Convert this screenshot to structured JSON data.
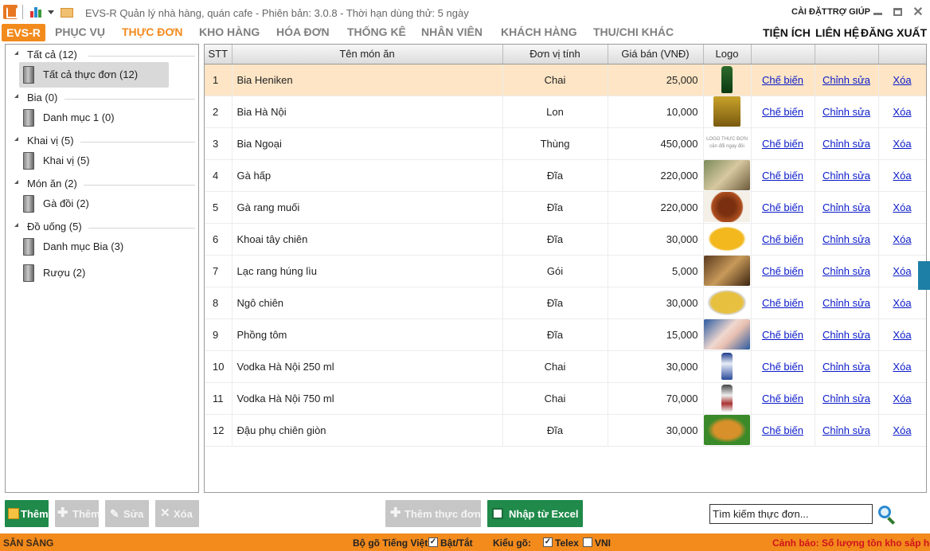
{
  "app": {
    "title": "EVS-R Quản lý nhà hàng, quán cafe - Phiên bản: 3.0.8 - Thời hạn dùng thử: 5 ngày",
    "settings": "CÀI ĐẶT",
    "help": "TRỢ GIÚP"
  },
  "menu": {
    "brand": "EVS-R",
    "items": [
      "PHỤC VỤ",
      "THỰC ĐƠN",
      "KHO HÀNG",
      "HÓA ĐƠN",
      "THỐNG KÊ",
      "NHÂN VIÊN",
      "KHÁCH HÀNG",
      "THU/CHI KHÁC"
    ],
    "active": "THỰC ĐƠN",
    "right": [
      "TIỆN ÍCH",
      "LIÊN HỆ",
      "ĐĂNG XUẤT"
    ]
  },
  "tree": [
    {
      "label": "Tất cả (12)",
      "children": [
        {
          "label": "Tất cả thực đơn (12)",
          "selected": true
        }
      ]
    },
    {
      "label": "Bia (0)",
      "children": [
        {
          "label": "Danh mục 1 (0)"
        }
      ]
    },
    {
      "label": "Khai vị (5)",
      "children": [
        {
          "label": "Khai vị (5)"
        }
      ]
    },
    {
      "label": "Món ăn (2)",
      "children": [
        {
          "label": "Gà đồi (2)"
        }
      ]
    },
    {
      "label": "Đồ uống (5)",
      "children": [
        {
          "label": "Danh mục Bia (3)"
        },
        {
          "label": "Rượu (2)"
        }
      ]
    }
  ],
  "table": {
    "headers": {
      "stt": "STT",
      "name": "Tên món ăn",
      "unit": "Đơn vị tính",
      "price": "Giá bán (VNĐ)",
      "logo": "Logo"
    },
    "link_labels": {
      "process": "Chế biến",
      "edit": "Chỉnh sửa",
      "delete": "Xóa"
    },
    "rows": [
      {
        "stt": "1",
        "name": "Bia Heniken",
        "unit": "Chai",
        "price": "25,000",
        "logo": "green-bottle",
        "selected": true
      },
      {
        "stt": "2",
        "name": "Bia Hà Nội",
        "unit": "Lon",
        "price": "10,000",
        "logo": "gold-can"
      },
      {
        "stt": "3",
        "name": "Bia Ngoại",
        "unit": "Thùng",
        "price": "450,000",
        "logo": "logo-placeholder"
      },
      {
        "stt": "4",
        "name": "Gà hấp",
        "unit": "Đĩa",
        "price": "220,000",
        "logo": "steamed-chicken"
      },
      {
        "stt": "5",
        "name": "Gà rang muối",
        "unit": "Đĩa",
        "price": "220,000",
        "logo": "salted-chicken"
      },
      {
        "stt": "6",
        "name": "Khoai tây chiên",
        "unit": "Đĩa",
        "price": "30,000",
        "logo": "french-fries"
      },
      {
        "stt": "7",
        "name": "Lạc rang húng lìu",
        "unit": "Gói",
        "price": "5,000",
        "logo": "roasted-peanuts"
      },
      {
        "stt": "8",
        "name": "Ngô chiên",
        "unit": "Đĩa",
        "price": "30,000",
        "logo": "fried-corn"
      },
      {
        "stt": "9",
        "name": "Phồng tôm",
        "unit": "Đĩa",
        "price": "15,000",
        "logo": "shrimp-crackers"
      },
      {
        "stt": "10",
        "name": "Vodka Hà Nội 250 ml",
        "unit": "Chai",
        "price": "30,000",
        "logo": "vodka-small"
      },
      {
        "stt": "11",
        "name": "Vodka Hà Nội 750 ml",
        "unit": "Chai",
        "price": "70,000",
        "logo": "vodka-large"
      },
      {
        "stt": "12",
        "name": "Đậu phụ chiên giòn",
        "unit": "Đĩa",
        "price": "30,000",
        "logo": "fried-tofu"
      }
    ],
    "logo_placeholder_text": "LOGO THỰC ĐƠN",
    "logo_placeholder_sub": "cần đổi ngay đồi"
  },
  "toolbar": {
    "add_category": "Thêm",
    "add_category_disabled": "Thêm",
    "edit": "Sửa",
    "delete": "Xóa",
    "add_menu": "Thêm thực đơn",
    "import_excel": "Nhập từ Excel",
    "search_placeholder": "Tìm kiếm thực đơn..."
  },
  "status": {
    "ready": "SẴN SÀNG",
    "ime_label": "Bộ gõ Tiếng Việt",
    "ime_toggle": "Bật/Tắt",
    "input_method_label": "Kiểu gõ:",
    "telex": "Telex",
    "vni": "VNI",
    "warning": "Cảnh báo: Số lượng tồn kho sắp hết"
  },
  "colors": {
    "accent": "#f28a1c",
    "green": "#1f8a4a",
    "link": "#0a1ac8",
    "selected_row": "#fde5c5",
    "warning": "#d0121c"
  }
}
